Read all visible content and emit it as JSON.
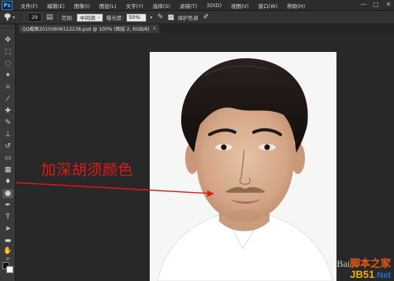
{
  "app": {
    "logo": "Ps"
  },
  "menu": [
    "文件(F)",
    "编辑(E)",
    "图像(I)",
    "图层(L)",
    "文字(Y)",
    "选择(S)",
    "滤镜(T)",
    "3D(D)",
    "视图(V)",
    "窗口(W)",
    "帮助(H)"
  ],
  "window_controls": {
    "minimize": "—",
    "maximize": "□",
    "close": "✕"
  },
  "options": {
    "brush_size": "29",
    "range_label": "范围:",
    "range_value": "中间调",
    "exposure_label": "曝光度:",
    "exposure_value": "50%",
    "protect_tones_checked": "✓",
    "protect_tones_label": "保护色调"
  },
  "document": {
    "tab_title": "QQ截图20150606112238.psd @ 100% (图层 2, RGB/8)",
    "close": "×"
  },
  "annotation": {
    "text": "加深胡须颜色",
    "color": "#e01818"
  },
  "watermark": {
    "baidu_prefix": "Bai",
    "site_cn": "脚本之家",
    "site_domain": "JB51",
    "site_tld": ".Net"
  },
  "icons": {
    "tool_preset": "burn-tool-icon",
    "airbrush": "airbrush-icon",
    "pressure": "pressure-icon"
  },
  "tools": [
    "move-tool",
    "marquee-tool",
    "lasso-tool",
    "quick-select-tool",
    "crop-tool",
    "eyedropper-tool",
    "healing-brush-tool",
    "brush-tool",
    "clone-stamp-tool",
    "history-brush-tool",
    "eraser-tool",
    "gradient-tool",
    "blur-tool",
    "burn-tool",
    "pen-tool",
    "type-tool",
    "path-select-tool",
    "shape-tool",
    "hand-tool",
    "zoom-tool"
  ]
}
